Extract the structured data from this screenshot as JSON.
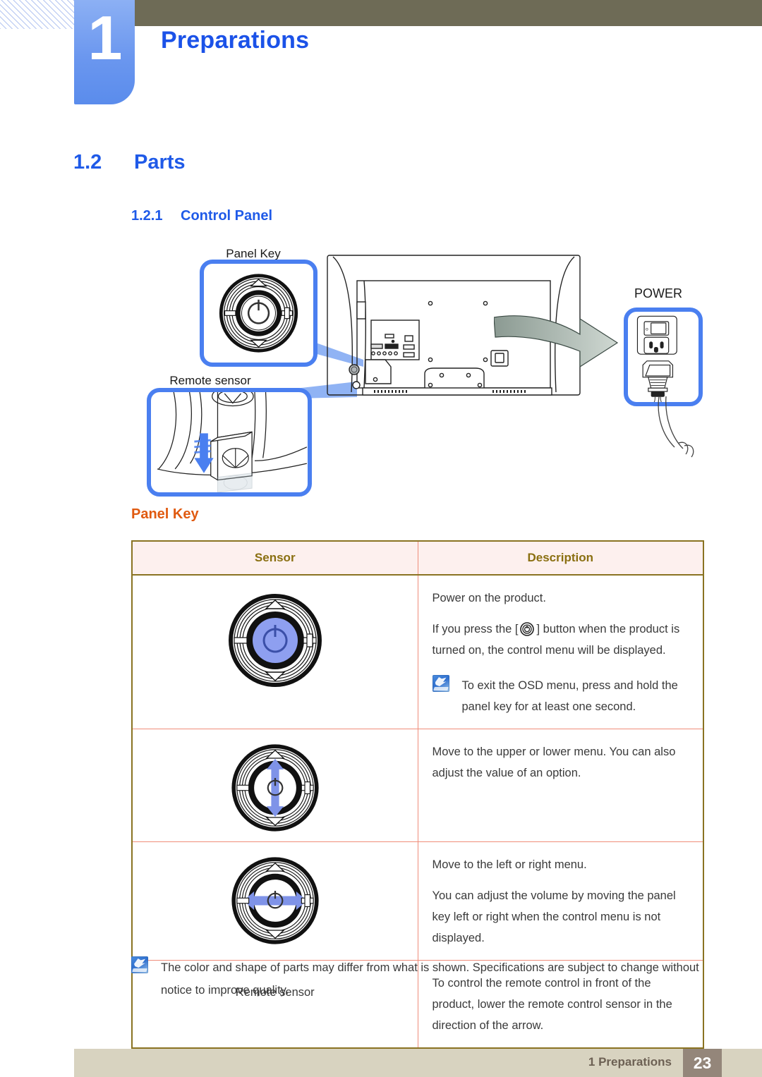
{
  "header": {
    "chapter_number": "1",
    "chapter_title": "Preparations"
  },
  "headings": {
    "section_number": "1.2",
    "section_title": "Parts",
    "subsection_number": "1.2.1",
    "subsection_title": "Control Panel",
    "orange_heading": "Panel Key"
  },
  "figure": {
    "panel_key_label": "Panel Key",
    "remote_sensor_label": "Remote sensor",
    "power_label": "POWER"
  },
  "table": {
    "columns": [
      "Sensor",
      "Description"
    ],
    "rows": [
      {
        "sensor_icon": "panel-key-power-icon",
        "lines": [
          "Power on the product.",
          "If you press the [",
          "] button when the product is turned on, the control menu will be displayed."
        ],
        "note": "To exit the OSD menu, press and hold the panel key for at least one second."
      },
      {
        "sensor_icon": "panel-key-up-down-icon",
        "lines": [
          "Move to the upper or lower menu. You can also adjust the value of an option."
        ]
      },
      {
        "sensor_icon": "panel-key-left-right-icon",
        "lines": [
          "Move to the left or right menu.",
          "You can adjust the volume by moving the panel key left or right when the control menu is not displayed."
        ]
      },
      {
        "sensor_text": "Remote sensor",
        "lines": [
          "To control the remote control in front of the product, lower the remote control sensor in the direction of the arrow."
        ]
      }
    ]
  },
  "footer_note": "The color and shape of parts may differ from what is shown. Specifications are subject to change without notice to improve quality.",
  "page_footer": {
    "label": "1 Preparations",
    "page_number": "23"
  },
  "colors": {
    "accent_blue": "#1f5ae8",
    "tab_blue": "#6b97ef",
    "olive": "#6e6b56",
    "orange_heading": "#e05a10",
    "table_border": "#8a7322",
    "table_inner_border": "#ef8d7a",
    "table_header_bg": "#fdf0ee",
    "footer_bar": "#d8d3c0",
    "footer_page_bg": "#94867a"
  }
}
